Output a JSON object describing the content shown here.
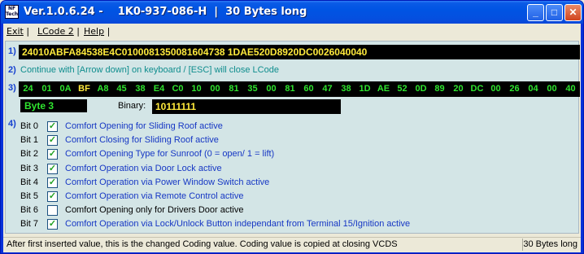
{
  "window": {
    "title": "Ver.1.0.6.24 -    1K0-937-086-H  |  30 Bytes long",
    "icon_text": "NF Tech",
    "minimize_glyph": "_",
    "maximize_glyph": "□",
    "close_glyph": "✕"
  },
  "menu": [
    {
      "label": "Exit",
      "sep": " |"
    },
    {
      "label": "LCode 2",
      "sep": " |"
    },
    {
      "label": "Help",
      "sep": " |"
    }
  ],
  "sections": [
    "1)",
    "2)",
    "3)",
    "4)"
  ],
  "coding_value": "24010ABFA84538E4C0100081350081604738 1DAE520D8920DC0026040040",
  "instruction": "Continue with [Arrow down] on keyboard / [ESC] will close LCode",
  "bytes": [
    "24",
    "01",
    "0A",
    "BF",
    "A8",
    "45",
    "38",
    "E4",
    "C0",
    "10",
    "00",
    "81",
    "35",
    "00",
    "81",
    "60",
    "47",
    "38",
    "1D",
    "AE",
    "52",
    "0D",
    "89",
    "20",
    "DC",
    "00",
    "26",
    "04",
    "00",
    "40"
  ],
  "selected_byte_index": 3,
  "byte_label": "Byte 3",
  "binary_caption": "Binary:",
  "binary_value": "10111111",
  "bits": [
    {
      "label": "Bit 0",
      "checked": true,
      "text": "Comfort Opening for Sliding Roof active"
    },
    {
      "label": "Bit 1",
      "checked": true,
      "text": "Comfort Closing for Sliding Roof active"
    },
    {
      "label": "Bit 2",
      "checked": true,
      "text": "Comfort Opening Type for Sunroof (0 = open/ 1 = lift)"
    },
    {
      "label": "Bit 3",
      "checked": true,
      "text": "Comfort Operation via Door Lock active"
    },
    {
      "label": "Bit 4",
      "checked": true,
      "text": "Comfort Operation via Power Window Switch active"
    },
    {
      "label": "Bit 5",
      "checked": true,
      "text": "Comfort Operation via Remote Control active"
    },
    {
      "label": "Bit 6",
      "checked": false,
      "text": "Comfort Opening only for Drivers Door active"
    },
    {
      "label": "Bit 7",
      "checked": true,
      "text": "Comfort Operation via Lock/Unlock Button independant from Terminal 15/Ignition active"
    }
  ],
  "status": {
    "main": "After first inserted value, this is the changed Coding value.  Coding value is copied at closing VCDS",
    "length": "30 Bytes long"
  },
  "colors": {
    "titlebar": "#0054e3",
    "panel": "#d3e5e6",
    "hex_text": "#ffea3c",
    "byte_text": "#2fe42f",
    "bit_text_active": "#1637c4",
    "instruction_text": "#0e8d8d",
    "check_mark": "#21a121"
  }
}
